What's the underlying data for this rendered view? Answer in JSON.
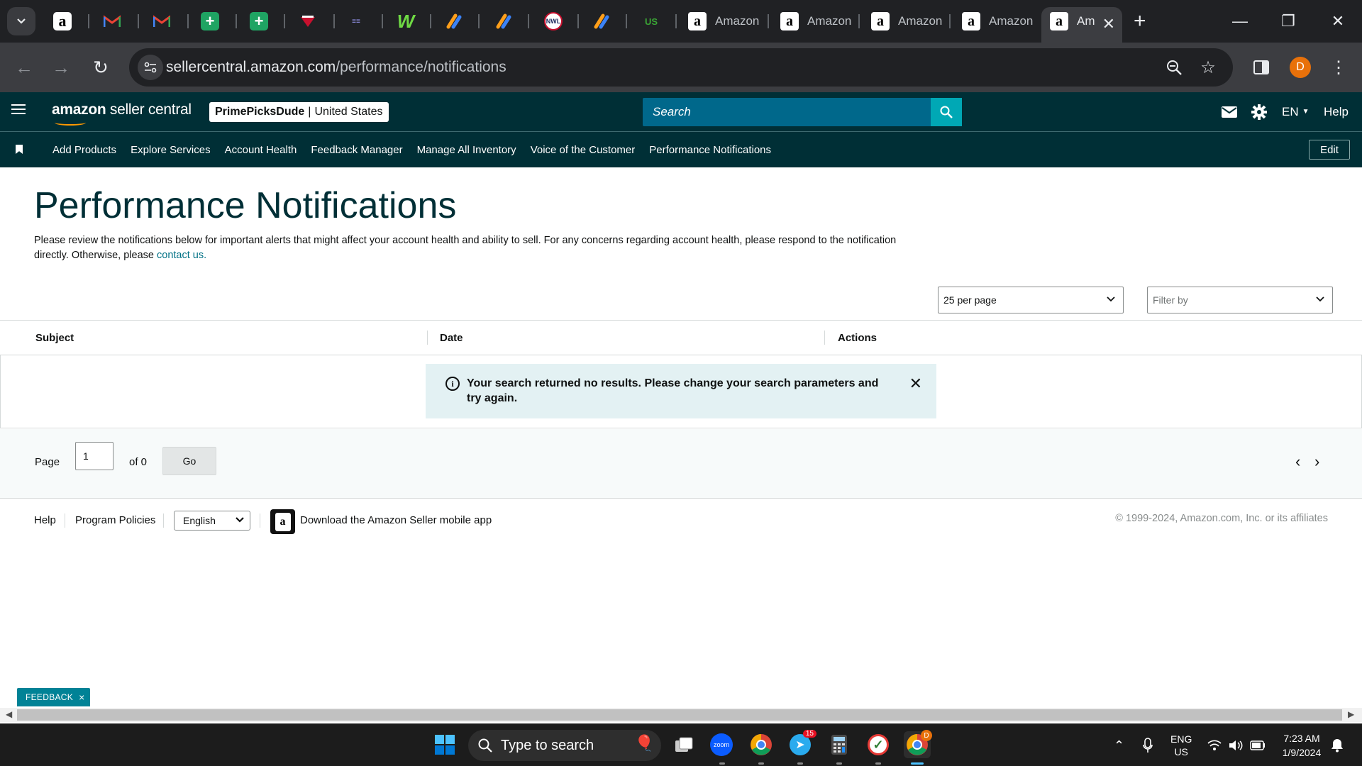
{
  "browser": {
    "tabs": [
      {
        "title": "Amazon"
      },
      {
        "title": "Amazon"
      },
      {
        "title": "Amazon"
      },
      {
        "title": "Amazon"
      },
      {
        "title": "Am",
        "active": true
      }
    ],
    "pinned_icons": [
      "amazon-icon",
      "gmail-icon",
      "gmail-icon",
      "sheets-icon",
      "sheets-icon",
      "chicago-icon",
      "apd-icon",
      "upwork-icon",
      "asana-icon",
      "asana-icon",
      "nwl-icon",
      "asana-icon",
      "usfoods-icon"
    ],
    "url_host": "sellercentral.amazon.com",
    "url_path": "/performance/notifications",
    "profile_initial": "D"
  },
  "header": {
    "logo_bold": "amazon",
    "logo_rest": " seller central",
    "store_name": "PrimePicksDude",
    "store_sep": " | ",
    "store_region": "United States",
    "search_placeholder": "Search",
    "language": "EN",
    "help": "Help"
  },
  "nav": {
    "items": [
      "Add Products",
      "Explore Services",
      "Account Health",
      "Feedback Manager",
      "Manage All Inventory",
      "Voice of the Customer",
      "Performance Notifications"
    ],
    "edit": "Edit"
  },
  "main": {
    "title": "Performance Notifications",
    "intro": "Please review the notifications below for important alerts that might affect your account health and ability to sell. For any concerns regarding account health, please respond to the notification directly. Otherwise, please ",
    "intro_link": "contact us.",
    "per_page": "25 per page",
    "filter_placeholder": "Filter by",
    "columns": [
      "Subject",
      "Date",
      "Actions"
    ],
    "alert": "Your search returned no results. Please change your search parameters and try again.",
    "pager": {
      "page_label": "Page",
      "page_value": "1",
      "of_label": "of 0",
      "go": "Go"
    }
  },
  "footer": {
    "help": "Help",
    "policies": "Program Policies",
    "language": "English",
    "app_text": "Download the Amazon Seller mobile app",
    "copyright": "© 1999-2024, Amazon.com, Inc. or its affiliates"
  },
  "feedback": {
    "label": "FEEDBACK",
    "close": "×"
  },
  "taskbar": {
    "search_placeholder": "Type to search",
    "telegram_badge": "15",
    "chrome_badge": "D",
    "lang_top": "ENG",
    "lang_bottom": "US",
    "time": "7:23 AM",
    "date": "1/9/2024"
  },
  "colors": {
    "header_bg": "#002f36",
    "search_bg": "#00688b",
    "search_btn": "#00a8b5",
    "link": "#007185",
    "alert_bg": "#e3f1f3",
    "feedback": "#008296"
  }
}
